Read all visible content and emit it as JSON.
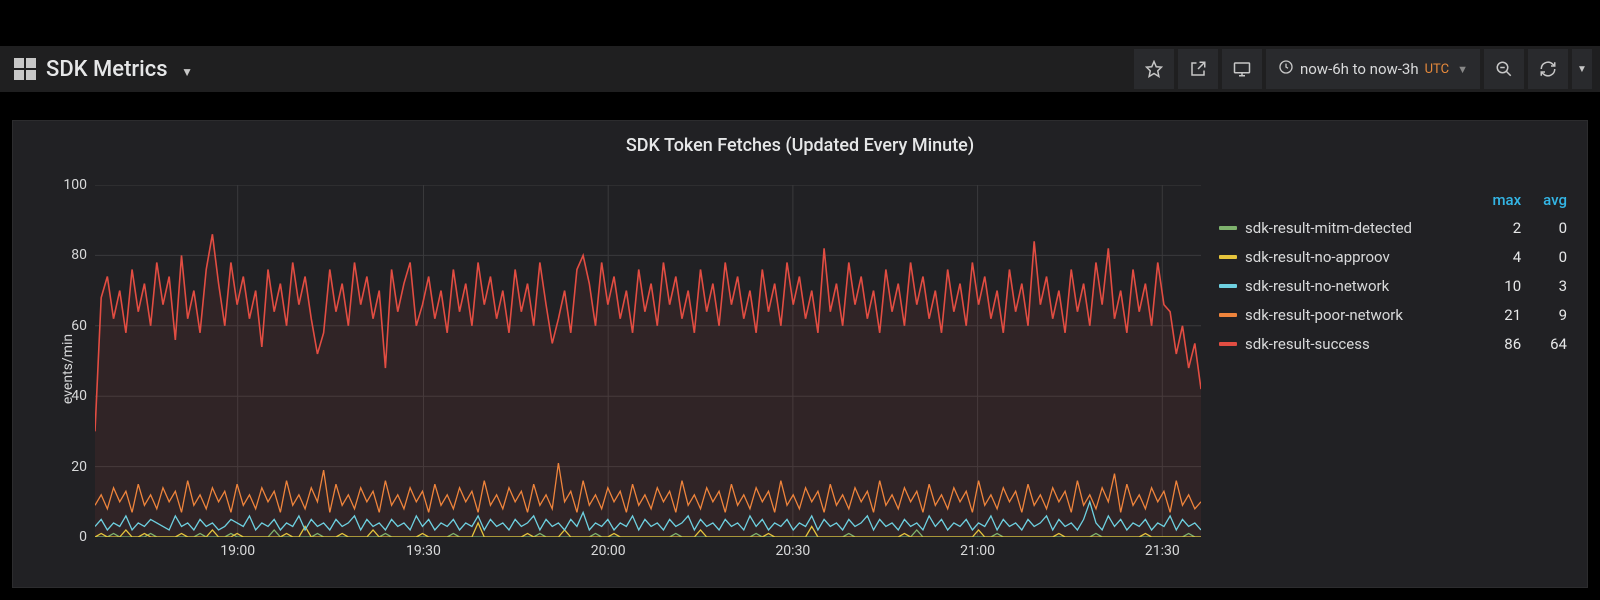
{
  "header": {
    "title": "SDK Metrics",
    "time_range": "now-6h to now-3h",
    "tz": "UTC"
  },
  "panel": {
    "title": "SDK Token Fetches (Updated Every Minute)"
  },
  "legend": {
    "headers": {
      "max": "max",
      "avg": "avg"
    },
    "rows": [
      {
        "label": "sdk-result-mitm-detected",
        "color": "#7eb26d",
        "max": 2,
        "avg": 0
      },
      {
        "label": "sdk-result-no-approov",
        "color": "#e5c43c",
        "max": 4,
        "avg": 0
      },
      {
        "label": "sdk-result-no-network",
        "color": "#6ed0e0",
        "max": 10,
        "avg": 3
      },
      {
        "label": "sdk-result-poor-network",
        "color": "#ef843c",
        "max": 21,
        "avg": 9
      },
      {
        "label": "sdk-result-success",
        "color": "#e24d42",
        "max": 86,
        "avg": 64
      }
    ]
  },
  "chart_data": {
    "type": "line",
    "title": "SDK Token Fetches (Updated Every Minute)",
    "xlabel": "",
    "ylabel": "events/min",
    "ylim": [
      0,
      100
    ],
    "y_ticks": [
      0,
      20,
      40,
      60,
      80,
      100
    ],
    "x_tick_labels": [
      "19:00",
      "19:30",
      "20:00",
      "20:30",
      "21:00",
      "21:30"
    ],
    "x_tick_positions_pct": [
      12.9,
      29.7,
      46.4,
      63.1,
      79.8,
      96.5
    ],
    "n_points": 180,
    "series": [
      {
        "name": "sdk-result-mitm-detected",
        "color": "#7eb26d",
        "values": [
          0,
          0,
          0,
          1,
          0,
          0,
          0,
          0,
          0,
          1,
          0,
          0,
          0,
          0,
          0,
          0,
          0,
          1,
          0,
          0,
          0,
          0,
          1,
          0,
          0,
          0,
          0,
          0,
          0,
          2,
          0,
          0,
          0,
          0,
          0,
          0,
          1,
          0,
          0,
          0,
          0,
          0,
          0,
          0,
          0,
          0,
          0,
          1,
          0,
          0,
          0,
          0,
          0,
          0,
          0,
          0,
          0,
          0,
          1,
          0,
          0,
          0,
          0,
          0,
          0,
          0,
          0,
          0,
          0,
          0,
          0,
          0,
          1,
          0,
          0,
          0,
          0,
          0,
          0,
          0,
          0,
          1,
          0,
          0,
          0,
          0,
          0,
          0,
          0,
          0,
          0,
          0,
          0,
          0,
          1,
          0,
          0,
          0,
          0,
          0,
          0,
          0,
          0,
          0,
          0,
          0,
          0,
          1,
          0,
          0,
          0,
          0,
          0,
          0,
          0,
          0,
          0,
          0,
          0,
          0,
          0,
          0,
          1,
          0,
          0,
          0,
          0,
          0,
          0,
          0,
          0,
          0,
          0,
          2,
          0,
          0,
          0,
          0,
          0,
          0,
          0,
          0,
          0,
          0,
          0,
          0,
          1,
          0,
          0,
          0,
          0,
          0,
          0,
          0,
          0,
          0,
          0,
          0,
          0,
          0,
          0,
          0,
          1,
          0,
          0,
          0,
          0,
          0,
          0,
          0,
          0,
          0,
          0,
          0,
          0,
          0,
          0,
          1,
          0,
          0
        ]
      },
      {
        "name": "sdk-result-no-approov",
        "color": "#e5c43c",
        "values": [
          0,
          1,
          0,
          0,
          0,
          2,
          0,
          0,
          1,
          0,
          0,
          0,
          0,
          0,
          1,
          0,
          0,
          0,
          0,
          2,
          0,
          0,
          0,
          1,
          0,
          0,
          0,
          0,
          0,
          0,
          0,
          1,
          0,
          0,
          3,
          0,
          0,
          0,
          0,
          0,
          1,
          0,
          0,
          0,
          0,
          2,
          0,
          0,
          0,
          0,
          0,
          0,
          0,
          1,
          0,
          0,
          0,
          0,
          0,
          0,
          0,
          0,
          4,
          0,
          0,
          0,
          0,
          0,
          0,
          0,
          1,
          0,
          0,
          0,
          0,
          0,
          2,
          0,
          0,
          0,
          0,
          0,
          0,
          0,
          1,
          0,
          0,
          0,
          0,
          0,
          0,
          0,
          0,
          0,
          0,
          0,
          0,
          0,
          2,
          0,
          0,
          0,
          0,
          0,
          0,
          0,
          0,
          0,
          0,
          1,
          0,
          0,
          0,
          0,
          0,
          0,
          3,
          0,
          0,
          0,
          0,
          0,
          0,
          0,
          0,
          0,
          0,
          0,
          0,
          0,
          0,
          1,
          0,
          0,
          0,
          0,
          0,
          0,
          0,
          0,
          0,
          0,
          0,
          2,
          0,
          0,
          0,
          0,
          0,
          0,
          0,
          0,
          0,
          0,
          0,
          0,
          1,
          0,
          0,
          0,
          0,
          0,
          0,
          0,
          0,
          0,
          0,
          0,
          0,
          0,
          1,
          0,
          0,
          0,
          0,
          0,
          0,
          0,
          0,
          0
        ]
      },
      {
        "name": "sdk-result-no-network",
        "color": "#6ed0e0",
        "values": [
          3,
          5,
          2,
          4,
          3,
          6,
          2,
          4,
          3,
          5,
          4,
          3,
          2,
          6,
          3,
          4,
          2,
          5,
          3,
          4,
          2,
          3,
          5,
          4,
          3,
          6,
          2,
          4,
          3,
          5,
          2,
          4,
          3,
          6,
          2,
          5,
          3,
          4,
          2,
          5,
          3,
          4,
          6,
          2,
          5,
          3,
          4,
          2,
          5,
          3,
          4,
          2,
          6,
          3,
          5,
          2,
          4,
          3,
          5,
          2,
          4,
          3,
          6,
          2,
          5,
          3,
          4,
          2,
          5,
          3,
          4,
          6,
          2,
          5,
          3,
          4,
          2,
          5,
          3,
          7,
          2,
          4,
          3,
          5,
          2,
          4,
          3,
          6,
          2,
          5,
          3,
          4,
          2,
          5,
          3,
          4,
          6,
          2,
          5,
          3,
          4,
          2,
          5,
          3,
          4,
          2,
          6,
          3,
          5,
          2,
          4,
          3,
          5,
          2,
          4,
          3,
          6,
          2,
          5,
          3,
          4,
          2,
          5,
          3,
          4,
          6,
          2,
          5,
          3,
          4,
          2,
          5,
          3,
          4,
          2,
          6,
          3,
          5,
          2,
          4,
          3,
          5,
          2,
          4,
          3,
          6,
          2,
          5,
          3,
          4,
          2,
          5,
          3,
          4,
          6,
          2,
          5,
          3,
          4,
          2,
          5,
          10,
          4,
          2,
          6,
          3,
          5,
          2,
          4,
          3,
          5,
          2,
          4,
          3,
          6,
          2,
          5,
          3,
          4,
          2
        ]
      },
      {
        "name": "sdk-result-poor-network",
        "color": "#ef843c",
        "values": [
          9,
          12,
          8,
          14,
          10,
          13,
          7,
          15,
          9,
          12,
          8,
          14,
          10,
          13,
          7,
          16,
          9,
          12,
          8,
          14,
          10,
          13,
          7,
          15,
          9,
          12,
          8,
          14,
          10,
          13,
          7,
          16,
          9,
          12,
          8,
          14,
          10,
          19,
          7,
          15,
          9,
          12,
          8,
          14,
          10,
          13,
          7,
          16,
          9,
          12,
          8,
          14,
          10,
          13,
          7,
          15,
          9,
          12,
          8,
          14,
          10,
          13,
          7,
          16,
          9,
          12,
          8,
          14,
          10,
          13,
          7,
          15,
          9,
          12,
          8,
          21,
          10,
          13,
          7,
          16,
          9,
          12,
          8,
          14,
          10,
          13,
          7,
          15,
          9,
          12,
          8,
          14,
          10,
          13,
          7,
          16,
          9,
          12,
          8,
          14,
          10,
          13,
          7,
          15,
          9,
          12,
          8,
          14,
          10,
          13,
          7,
          16,
          9,
          12,
          8,
          14,
          10,
          13,
          7,
          15,
          9,
          12,
          8,
          14,
          10,
          13,
          7,
          16,
          9,
          12,
          8,
          14,
          10,
          13,
          7,
          15,
          9,
          12,
          8,
          14,
          10,
          13,
          7,
          16,
          9,
          12,
          8,
          14,
          10,
          13,
          7,
          15,
          9,
          12,
          8,
          14,
          10,
          13,
          7,
          16,
          9,
          12,
          8,
          14,
          10,
          18,
          7,
          15,
          9,
          12,
          8,
          14,
          10,
          13,
          7,
          16,
          9,
          12,
          8,
          10
        ]
      },
      {
        "name": "sdk-result-success",
        "color": "#e24d42",
        "values": [
          30,
          68,
          74,
          62,
          70,
          58,
          76,
          64,
          72,
          60,
          78,
          66,
          74,
          56,
          80,
          62,
          70,
          58,
          76,
          86,
          72,
          60,
          78,
          66,
          74,
          62,
          70,
          54,
          76,
          64,
          72,
          60,
          78,
          66,
          74,
          62,
          52,
          58,
          76,
          64,
          72,
          60,
          78,
          66,
          74,
          62,
          70,
          48,
          76,
          64,
          72,
          78,
          60,
          66,
          74,
          62,
          70,
          58,
          76,
          64,
          72,
          60,
          78,
          66,
          74,
          62,
          70,
          58,
          76,
          64,
          72,
          60,
          78,
          66,
          55,
          62,
          70,
          58,
          76,
          80,
          72,
          60,
          78,
          66,
          74,
          62,
          70,
          58,
          76,
          64,
          72,
          60,
          78,
          66,
          74,
          62,
          70,
          58,
          76,
          64,
          72,
          60,
          78,
          66,
          74,
          62,
          70,
          58,
          76,
          64,
          72,
          60,
          78,
          66,
          74,
          62,
          70,
          58,
          82,
          64,
          72,
          60,
          78,
          66,
          74,
          62,
          70,
          58,
          76,
          64,
          72,
          60,
          78,
          66,
          74,
          62,
          70,
          58,
          76,
          64,
          72,
          60,
          78,
          66,
          74,
          62,
          70,
          58,
          76,
          64,
          72,
          60,
          84,
          66,
          74,
          62,
          70,
          58,
          76,
          64,
          72,
          60,
          78,
          66,
          82,
          62,
          70,
          58,
          76,
          64,
          72,
          60,
          78,
          66,
          64,
          52,
          60,
          48,
          55,
          42
        ]
      }
    ]
  }
}
